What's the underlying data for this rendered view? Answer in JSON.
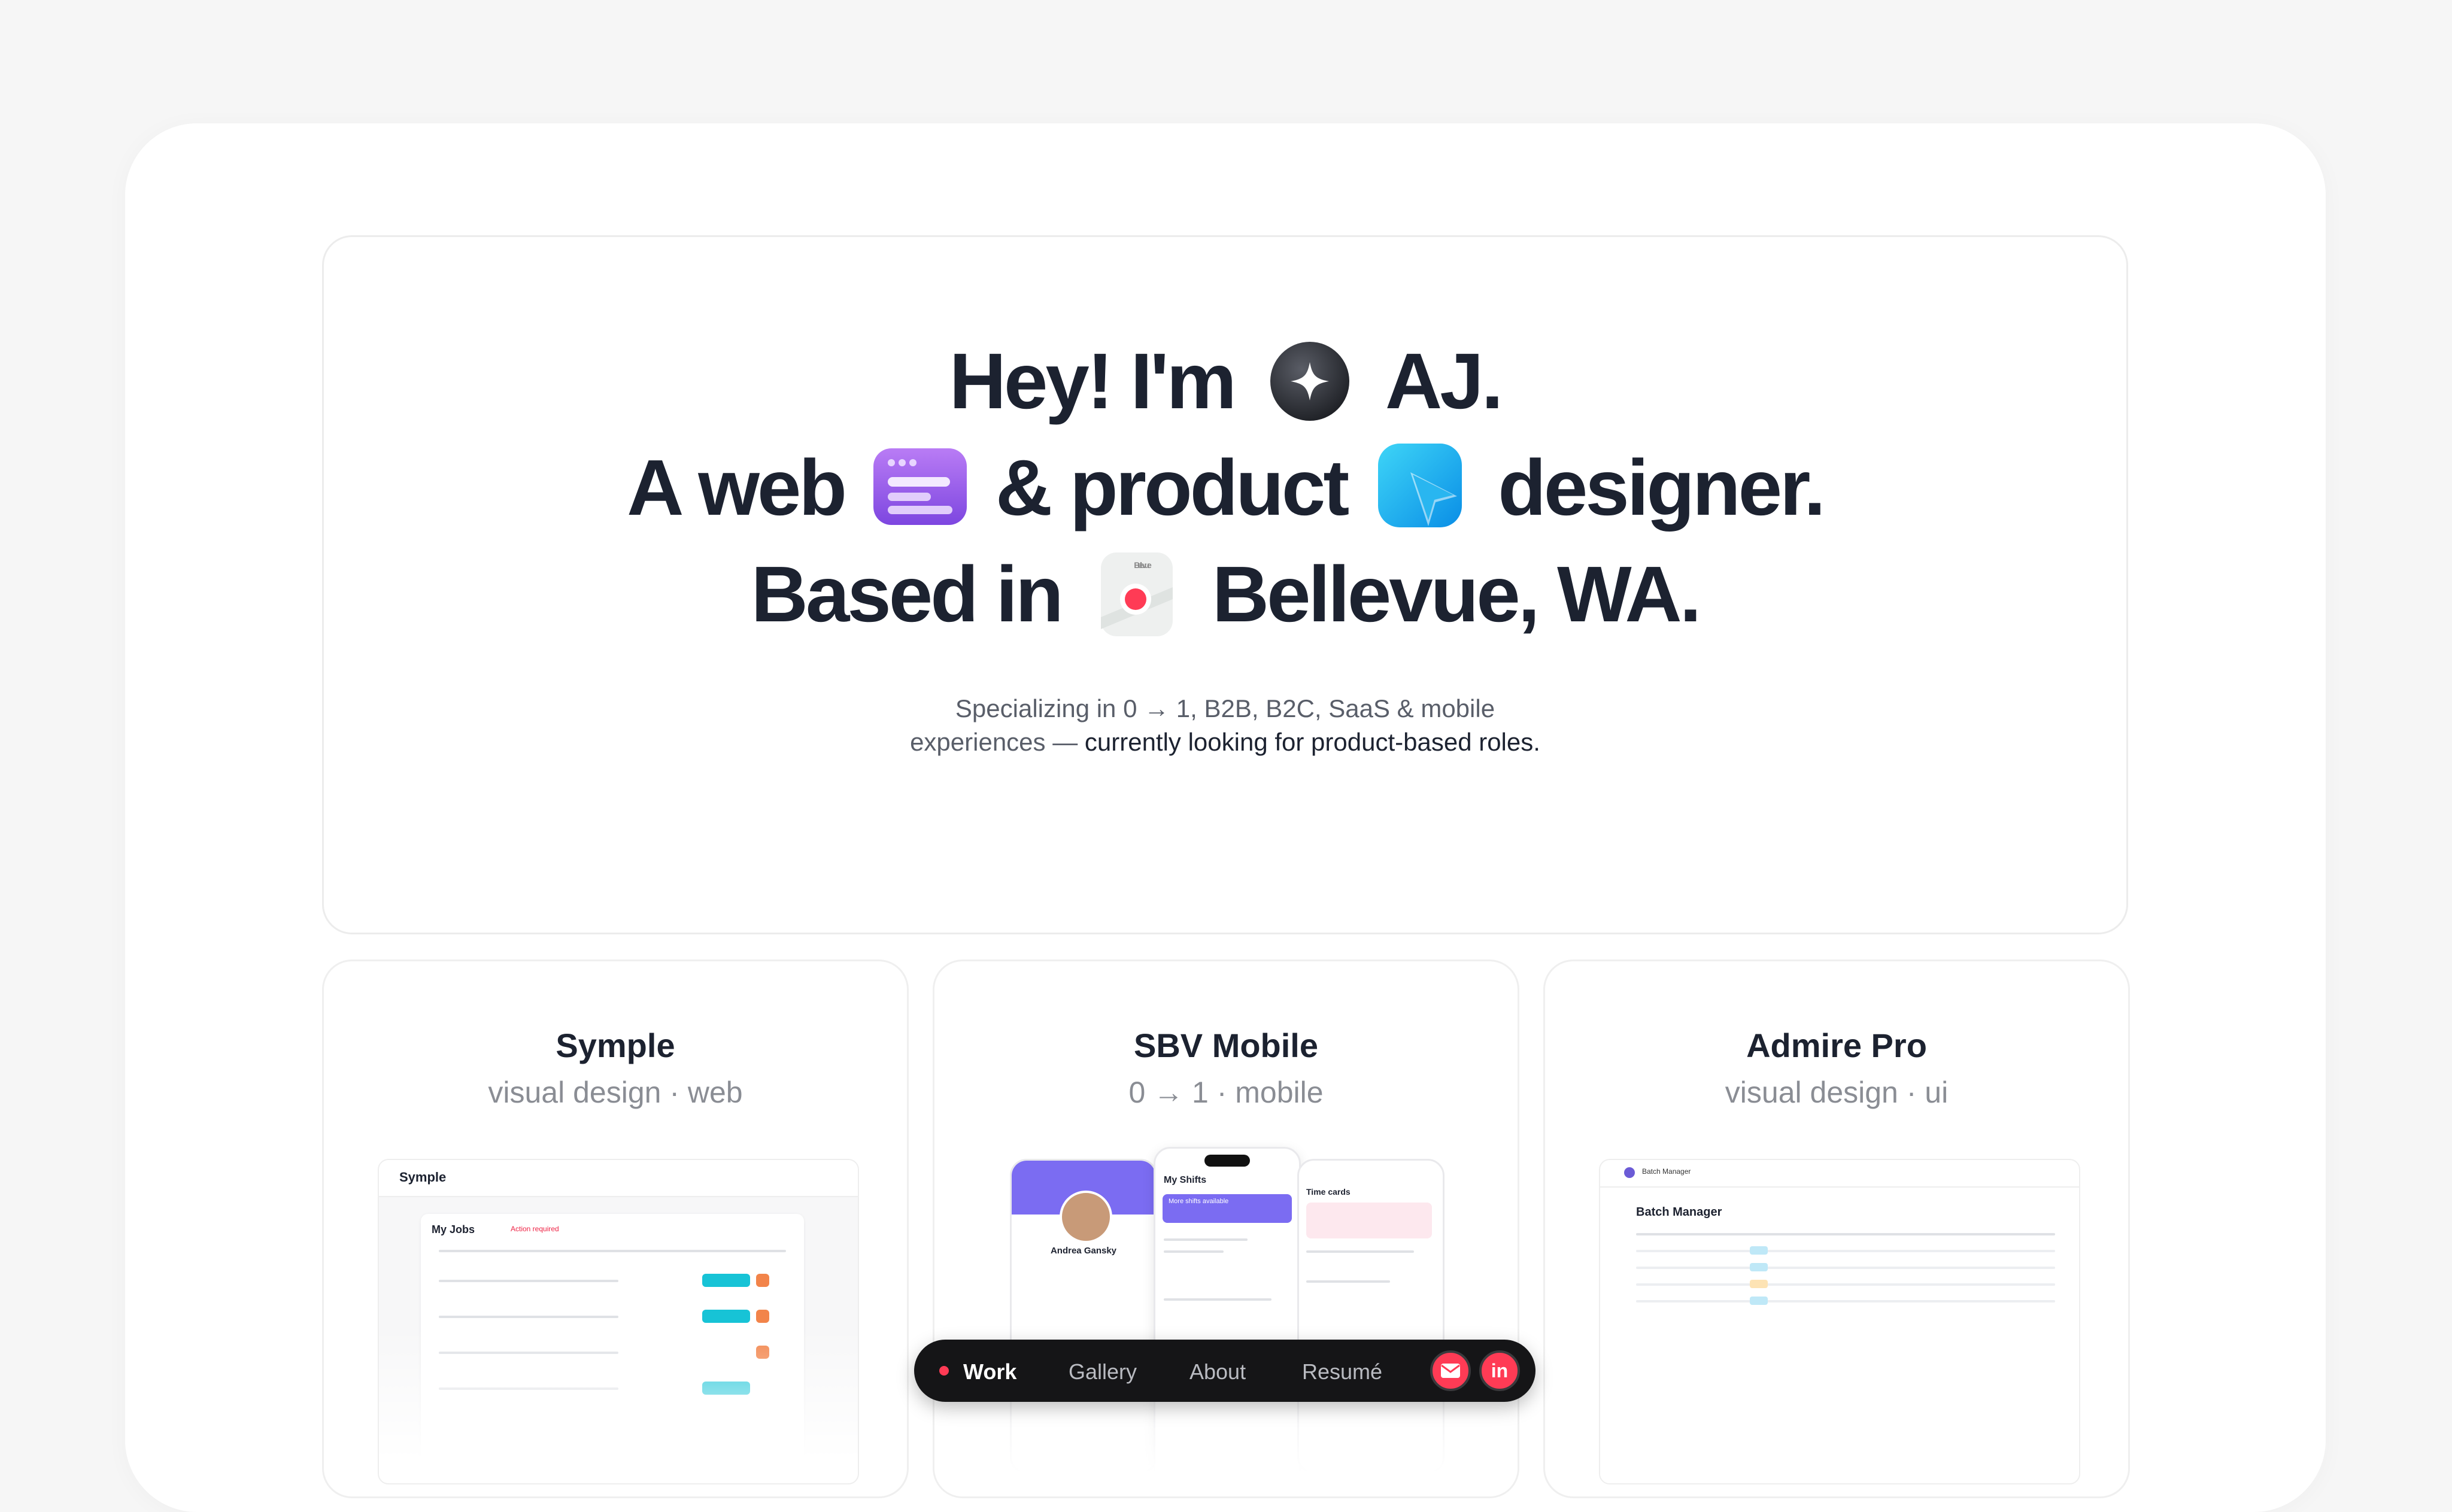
{
  "hero": {
    "line1_a": "Hey! I'm",
    "line1_b": "AJ.",
    "line2_a": "A web",
    "line2_b": "& product",
    "line2_c": "designer.",
    "line3_a": "Based in",
    "line3_b": "Bellevue, WA.",
    "map_label": "Bellevue",
    "sub_line1": "Specializing in 0 → 1, B2B, B2C, SaaS & mobile",
    "sub_line2_plain": "experiences —",
    "sub_line2_bold": "currently looking for product-based roles."
  },
  "projects": [
    {
      "title": "Symple",
      "tags": "visual design · web"
    },
    {
      "title": "SBV Mobile",
      "tags": "0 → 1 · mobile"
    },
    {
      "title": "Admire Pro",
      "tags": "visual design · ui"
    }
  ],
  "previews": {
    "symple_logo": "Symple",
    "symple_heading": "My Jobs",
    "symple_alert": "Action required",
    "sbv_heading": "My Shifts",
    "sbv_name": "Andrea Gansky",
    "sbv_banner": "More shifts available",
    "sbv_card_title": "Time cards",
    "admire_app": "Batch Manager",
    "admire_heading": "Batch Manager"
  },
  "navbar": {
    "items": [
      "Work",
      "Gallery",
      "About",
      "Resumé"
    ],
    "active": "Work",
    "mail_icon": "mail-icon",
    "linkedin_label": "in"
  },
  "colors": {
    "accent": "#ff3b55",
    "text": "#1c2230",
    "muted": "#8a8d94",
    "navbar_bg": "#151517"
  }
}
